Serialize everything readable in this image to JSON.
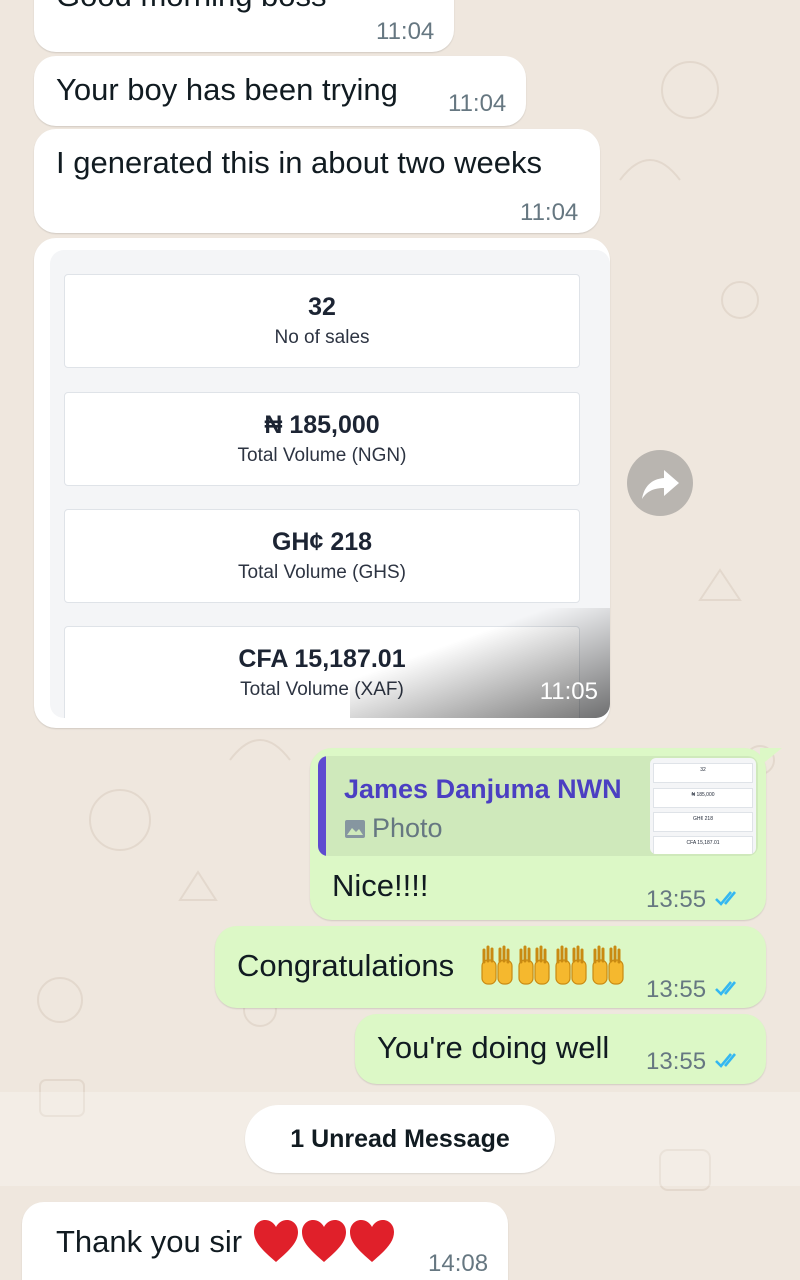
{
  "messages": {
    "m1": {
      "text": "Good morning boss",
      "time": "11:04"
    },
    "m2": {
      "text": "Your boy has been trying",
      "time": "11:04"
    },
    "m3": {
      "text": "I generated this in about two weeks",
      "time": "11:04"
    },
    "image_message": {
      "time": "11:05",
      "stats": [
        {
          "value": "32",
          "label": "No of sales"
        },
        {
          "value": "₦ 185,000",
          "label": "Total Volume (NGN)"
        },
        {
          "value": "GH¢ 218",
          "label": "Total Volume (GHS)"
        },
        {
          "value": "CFA 15,187.01",
          "label": "Total Volume (XAF)"
        }
      ]
    },
    "reply": {
      "quoted_author": "James Danjuma NWN",
      "quoted_type": "Photo",
      "text": "Nice!!!!",
      "time": "13:55"
    },
    "m5": {
      "text": "Congratulations",
      "time": "13:55",
      "emoji": "raising-hands x4"
    },
    "m6": {
      "text": "You're doing well",
      "time": "13:55"
    },
    "m7": {
      "text": "Thank you sir",
      "time": "14:08",
      "emoji": "red-heart x3"
    }
  },
  "system": {
    "unread": "1 Unread Message"
  },
  "colors": {
    "outgoing_bubble": "#dcf8c6",
    "incoming_bubble": "#ffffff",
    "read_ticks": "#34b7f1",
    "quote_author": "#4b3fc2",
    "background": "#efe7de"
  }
}
